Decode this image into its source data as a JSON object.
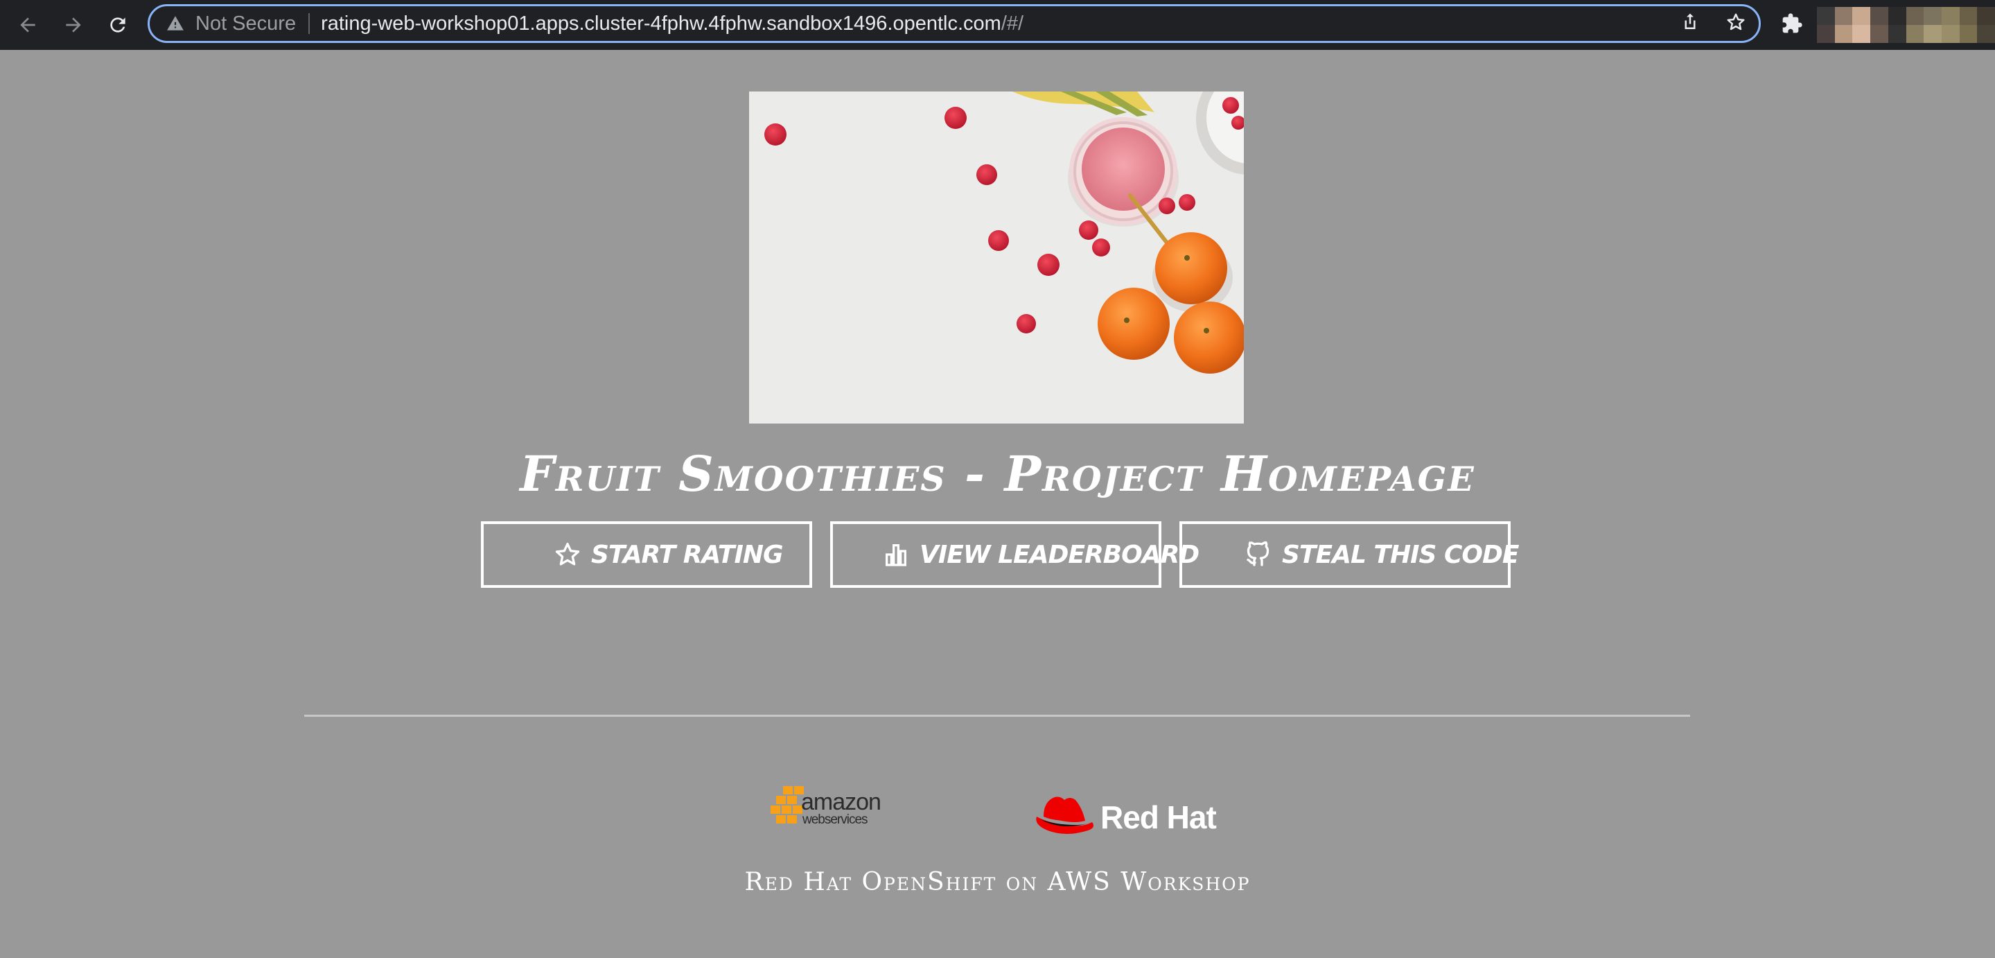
{
  "browser": {
    "security_label": "Not Secure",
    "url_host": "rating-web-workshop01.apps.cluster-4fphw.4fphw.sandbox1496.opentlc.com",
    "url_path": "/#/"
  },
  "page": {
    "title": "Fruit Smoothies - Project Homepage",
    "buttons": [
      {
        "label": "Start Rating",
        "icon": "star-icon"
      },
      {
        "label": "View Leaderboard",
        "icon": "bar-chart-icon"
      },
      {
        "label": "Steal This Code",
        "icon": "github-icon"
      }
    ],
    "footer": {
      "aws_line1": "amazon",
      "aws_line2": "webservices",
      "redhat_label": "Red Hat",
      "caption": "Red Hat OpenShift on AWS Workshop"
    }
  },
  "colors": {
    "page_bg": "#999999",
    "chrome_bg": "#202124",
    "focus_ring": "#8ab4f8",
    "aws_orange": "#f7a11a",
    "redhat_red": "#ee0000"
  }
}
